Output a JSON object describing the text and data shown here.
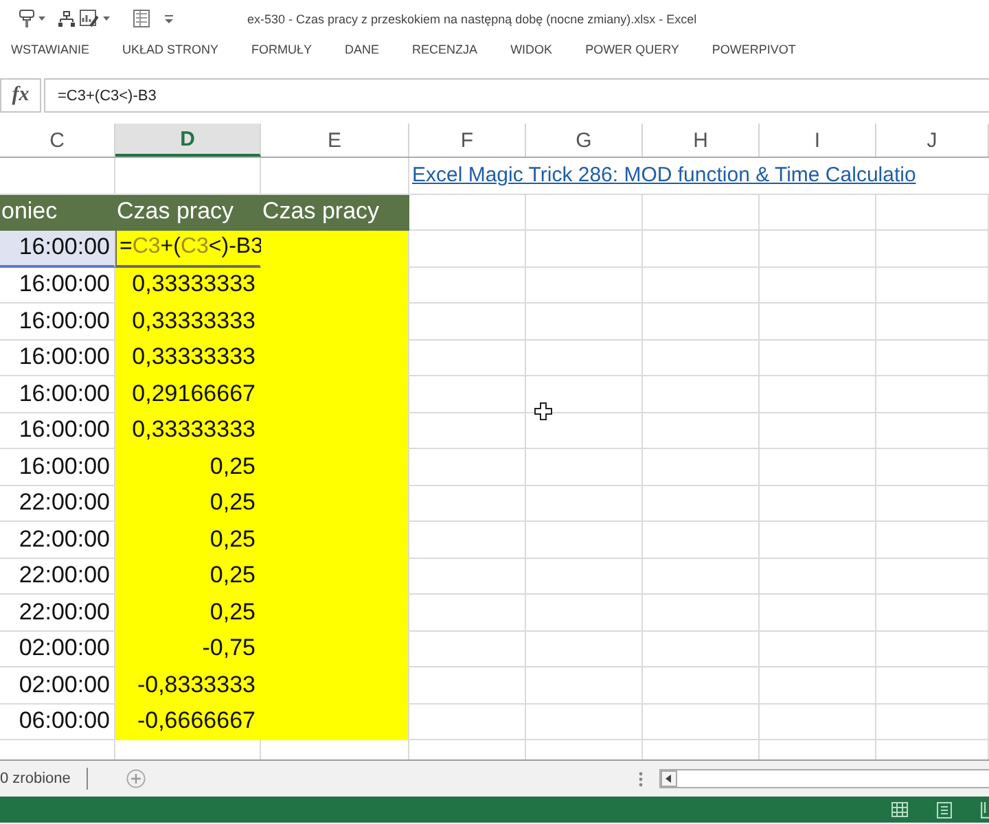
{
  "window": {
    "title": "ex-530 - Czas pracy z przeskokiem na następną dobę (nocne zmiany).xlsx - Excel"
  },
  "ribbon_tabs": [
    {
      "label": "WSTAWIANIE",
      "selected": false
    },
    {
      "label": "UKŁAD STRONY",
      "selected": false
    },
    {
      "label": "FORMUŁY",
      "selected": false
    },
    {
      "label": "DANE",
      "selected": false
    },
    {
      "label": "RECENZJA",
      "selected": false
    },
    {
      "label": "WIDOK",
      "selected": false
    },
    {
      "label": "POWER QUERY",
      "selected": false
    },
    {
      "label": "POWERPIVOT",
      "selected": false
    }
  ],
  "formula_bar": {
    "function_label": "fx",
    "value": "=C3+(C3<)-B3"
  },
  "columns": [
    {
      "label": "C",
      "selected": false
    },
    {
      "label": "D",
      "selected": true
    },
    {
      "label": "E",
      "selected": false
    },
    {
      "label": "F",
      "selected": false
    },
    {
      "label": "G",
      "selected": false
    },
    {
      "label": "H",
      "selected": false
    },
    {
      "label": "I",
      "selected": false
    },
    {
      "label": "J",
      "selected": false
    }
  ],
  "link": {
    "text": "Excel Magic Trick 286: MOD function & Time Calculatio"
  },
  "table": {
    "headers": [
      "oniec",
      "Czas pracy",
      "Czas pracy"
    ],
    "rows": [
      {
        "c": "16:00:00",
        "c_referenced": true,
        "editing": true,
        "d_formula": [
          {
            "text": "=",
            "kind": "plain"
          },
          {
            "text": "C3",
            "kind": "reference"
          },
          {
            "text": "+(",
            "kind": "plain"
          },
          {
            "text": "C3",
            "kind": "reference"
          },
          {
            "text": "<)-B3",
            "kind": "plain"
          }
        ]
      },
      {
        "c": "16:00:00",
        "c_referenced": false,
        "editing": false,
        "d": "0,33333333"
      },
      {
        "c": "16:00:00",
        "c_referenced": false,
        "editing": false,
        "d": "0,33333333"
      },
      {
        "c": "16:00:00",
        "c_referenced": false,
        "editing": false,
        "d": "0,33333333"
      },
      {
        "c": "16:00:00",
        "c_referenced": false,
        "editing": false,
        "d": "0,29166667"
      },
      {
        "c": "16:00:00",
        "c_referenced": false,
        "editing": false,
        "d": "0,33333333"
      },
      {
        "c": "16:00:00",
        "c_referenced": false,
        "editing": false,
        "d": "0,25"
      },
      {
        "c": "22:00:00",
        "c_referenced": false,
        "editing": false,
        "d": "0,25"
      },
      {
        "c": "22:00:00",
        "c_referenced": false,
        "editing": false,
        "d": "0,25"
      },
      {
        "c": "22:00:00",
        "c_referenced": false,
        "editing": false,
        "d": "0,25"
      },
      {
        "c": "22:00:00",
        "c_referenced": false,
        "editing": false,
        "d": "0,25"
      },
      {
        "c": "02:00:00",
        "c_referenced": false,
        "editing": false,
        "d": "-0,75"
      },
      {
        "c": "02:00:00",
        "c_referenced": false,
        "editing": false,
        "d": "-0,8333333"
      },
      {
        "c": "06:00:00",
        "c_referenced": false,
        "editing": false,
        "d": "-0,6666667"
      }
    ]
  },
  "sheet_tabs": [
    {
      "label": "0 zrobione",
      "selected": false
    }
  ]
}
